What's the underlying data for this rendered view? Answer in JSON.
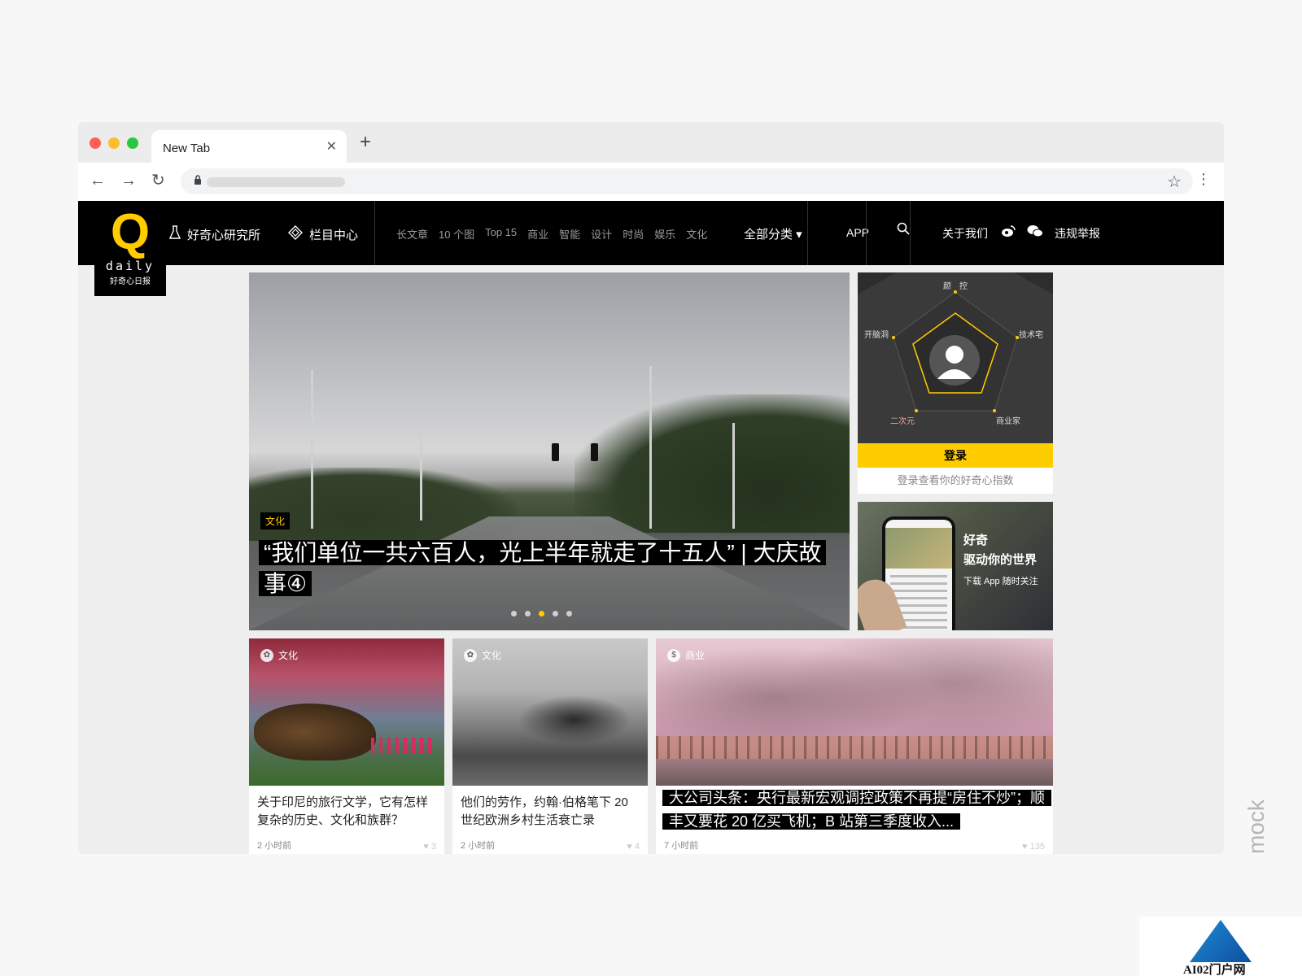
{
  "browser": {
    "tab_title": "New Tab",
    "tab_close": "✕",
    "new_tab": "+",
    "back": "←",
    "forward": "→",
    "reload": "↻",
    "lock": "🔒",
    "star": "☆",
    "menu": "⋮"
  },
  "header": {
    "logo_letter": "Q",
    "logo_daily": "daily",
    "logo_sub": "好奇心日报",
    "lab_icon": "flask-icon",
    "lab_label": "好奇心研究所",
    "column_icon": "diamond-icon",
    "column_label": "栏目中心",
    "categories": [
      "长文章",
      "10 个图",
      "Top 15",
      "商业",
      "智能",
      "设计",
      "时尚",
      "娱乐",
      "文化"
    ],
    "all_categories": "全部分类 ▾",
    "app": "APP",
    "search_icon": "search-icon",
    "about": "关于我们",
    "weibo_icon": "weibo-icon",
    "wechat_icon": "wechat-icon",
    "report": "违规举报"
  },
  "hero": {
    "tag": "文化",
    "title": "“我们单位一共六百人，光上半年就走了十五人” | 大庆故事④",
    "dots_count": 5,
    "active_dot": 2
  },
  "login_card": {
    "radar_labels": {
      "top": "颜　控",
      "left": "开脑洞",
      "right": "技术宅",
      "bottom_left": "二次元",
      "bottom_right": "商业家"
    },
    "login_button": "登录",
    "hint": "登录查看你的好奇心指数"
  },
  "app_promo": {
    "line1": "好奇",
    "line2": "驱动你的世界",
    "line3": "下载 App  随时关注"
  },
  "articles": [
    {
      "category": "文化",
      "title": "关于印尼的旅行文学，它有怎样复杂的历史、文化和族群？",
      "time": "2 小时前",
      "likes": "3"
    },
    {
      "category": "文化",
      "title": "他们的劳作，约翰·伯格笔下 20 世纪欧洲乡村生活衰亡录",
      "time": "2 小时前",
      "likes": "4"
    },
    {
      "category": "商业",
      "title": "大公司头条：央行最新宏观调控政策不再提“房住不炒”；顺丰又要花 20 亿买飞机；B 站第三季度收入...",
      "time": "7 小时前",
      "likes": "135"
    }
  ],
  "watermarks": {
    "mock": "mock",
    "badge": "AI02门户网"
  },
  "colors": {
    "accent": "#ffcc00",
    "header_bg": "#000000",
    "page_bg": "#eeeeee"
  }
}
